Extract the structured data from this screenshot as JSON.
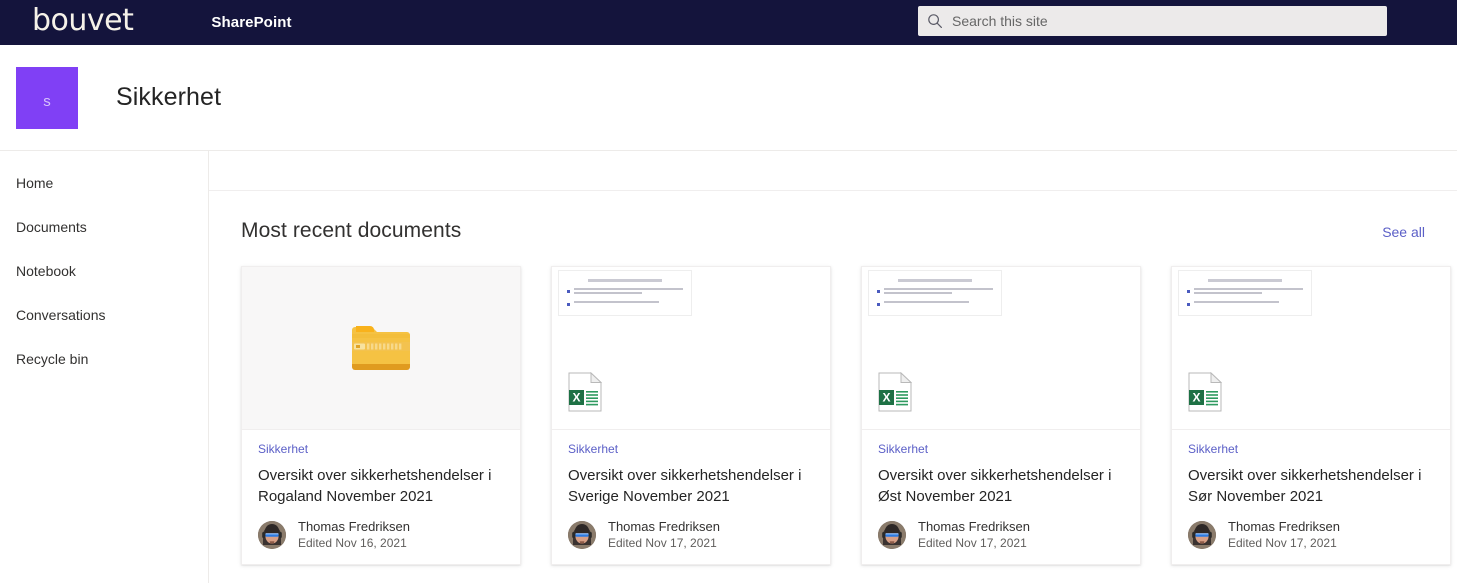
{
  "suite_bar": {
    "brand_logo_text": "bouvet",
    "app_name": "SharePoint",
    "search": {
      "placeholder": "Search this site",
      "value": "",
      "icon": "search-icon"
    }
  },
  "site_header": {
    "logo_letter": "s",
    "logo_color": "#8040f5",
    "title": "Sikkerhet"
  },
  "left_nav": {
    "items": [
      {
        "label": "Home"
      },
      {
        "label": "Documents"
      },
      {
        "label": "Notebook"
      },
      {
        "label": "Conversations"
      },
      {
        "label": "Recycle bin"
      }
    ]
  },
  "main": {
    "section_title": "Most recent documents",
    "see_all_label": "See all",
    "accent_link_color": "#5b5fc7",
    "cards": [
      {
        "site": "Sikkerhet",
        "title": "Oversikt over sikkerhetshendelser i Rogaland November 2021",
        "author": "Thomas Fredriksen",
        "edited": "Edited Nov 16, 2021",
        "file_icon": "zip-folder-icon",
        "thumb_type": "zip"
      },
      {
        "site": "Sikkerhet",
        "title": "Oversikt over sikkerhetshendelser i Sverige November 2021",
        "author": "Thomas Fredriksen",
        "edited": "Edited Nov 17, 2021",
        "file_icon": "excel-file-icon",
        "thumb_type": "document"
      },
      {
        "site": "Sikkerhet",
        "title": "Oversikt over sikkerhetshendelser i Øst November 2021",
        "author": "Thomas Fredriksen",
        "edited": "Edited Nov 17, 2021",
        "file_icon": "excel-file-icon",
        "thumb_type": "document"
      },
      {
        "site": "Sikkerhet",
        "title": "Oversikt over sikkerhetshendelser i Sør November 2021",
        "author": "Thomas Fredriksen",
        "edited": "Edited Nov 17, 2021",
        "file_icon": "excel-file-icon",
        "thumb_type": "document"
      }
    ]
  }
}
